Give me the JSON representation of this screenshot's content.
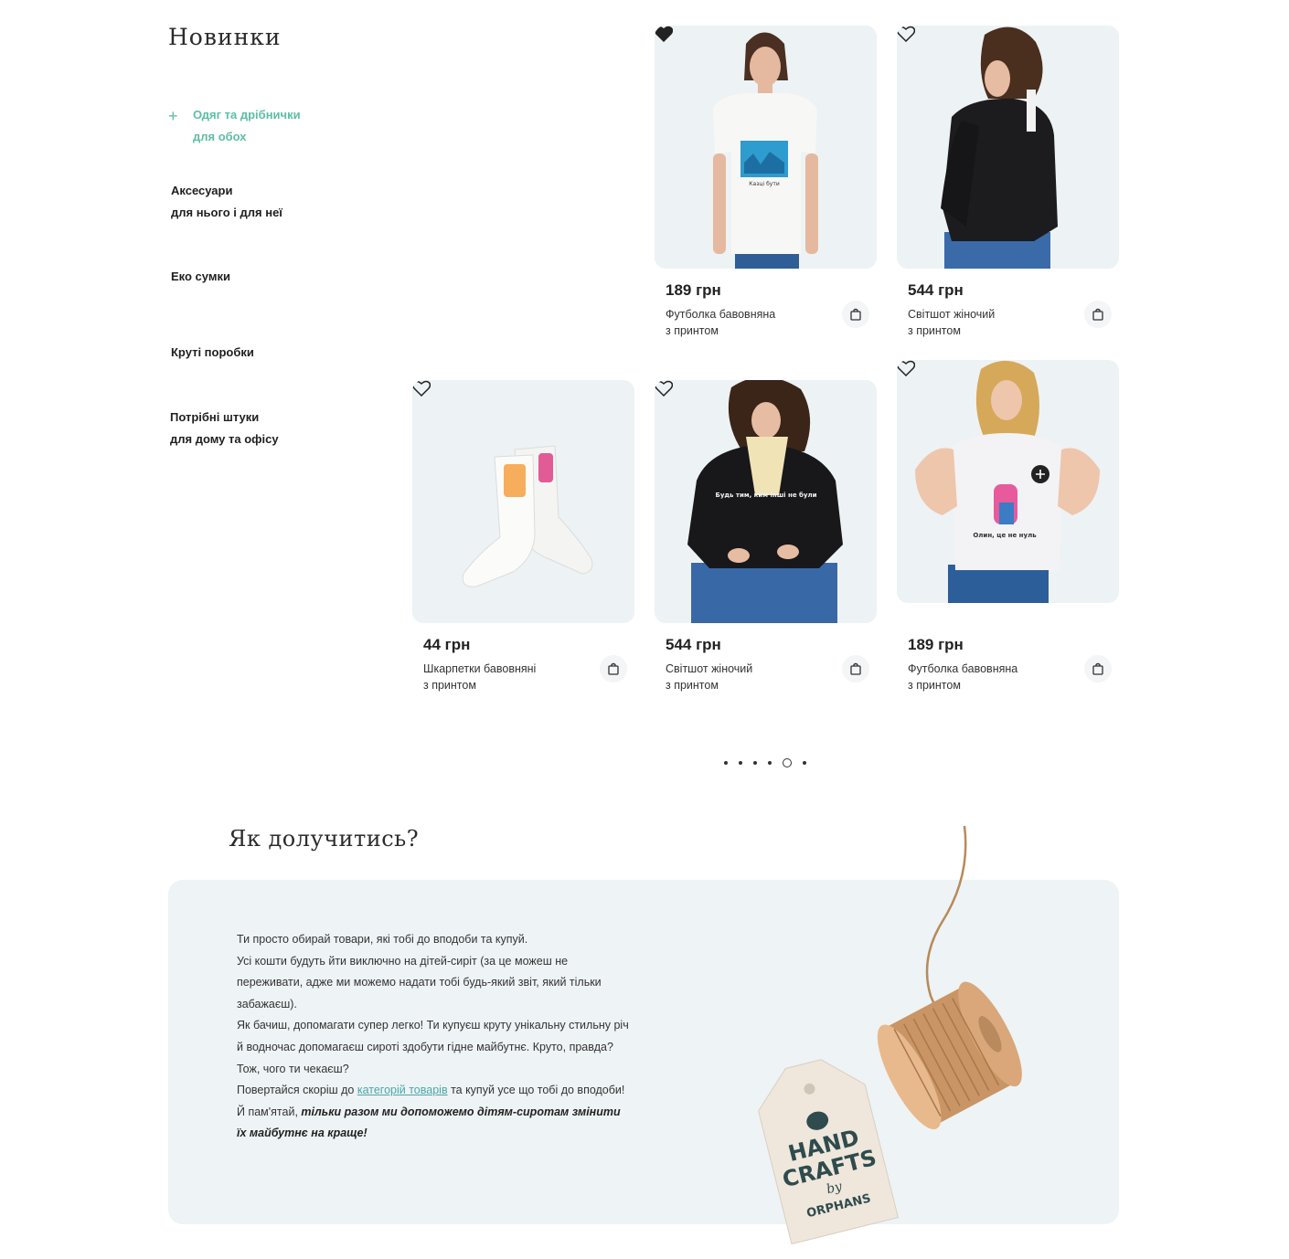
{
  "sections": {
    "new_title": "Новинки",
    "join_title": "Як долучитись?"
  },
  "categories": [
    {
      "line1": "Одяг та дрібнички",
      "line2": "для обох",
      "active": true
    },
    {
      "line1": "Аксесуари",
      "line2": "для нього і для неї",
      "active": false
    },
    {
      "line1": "Еко сумки",
      "line2": "",
      "active": false
    },
    {
      "line1": "Круті поробки",
      "line2": "",
      "active": false
    },
    {
      "line1": "Потрібні штуки",
      "line2": "для дому та офісу",
      "active": false
    }
  ],
  "products": [
    {
      "price": "189 грн",
      "name_line1": "Футболка бавовняна",
      "name_line2": "з принтом",
      "favorite": true,
      "image": "woman-white-tshirt"
    },
    {
      "price": "544 грн",
      "name_line1": "Світшот жіночий",
      "name_line2": "з принтом",
      "favorite": false,
      "image": "woman-black-sweatshirt-back"
    },
    {
      "price": "44 грн",
      "name_line1": "Шкарпетки бавовняні",
      "name_line2": "з принтом",
      "favorite": false,
      "image": "white-socks"
    },
    {
      "price": "544 грн",
      "name_line1": "Світшот жіночий",
      "name_line2": "з принтом",
      "favorite": false,
      "image": "woman-black-sweatshirt-front"
    },
    {
      "price": "189 грн",
      "name_line1": "Футболка бавовняна",
      "name_line2": "з принтом",
      "favorite": false,
      "image": "woman-white-tshirt-smiling"
    }
  ],
  "print_labels": {
    "tshirt1": "Казці бути",
    "sweatshirt": "Будь тим, ким інші не були",
    "tshirt2": "Олин, це не нуль"
  },
  "pagination": {
    "count": 6,
    "active_index": 4
  },
  "join_text": {
    "p1": "Ти просто обирай товари, які тобі до вподоби та купуй.",
    "p2": "Усі кошти будуть йти виключно на дітей-сиріт (за це можеш не переживати, адже ми можемо надати тобі будь-який звіт, який тільки забажаєш).",
    "p3": "Як бачиш, допомагати супер легко! Ти купуєш круту унікальну стильну річ й водночас допомагаєш сироті здобути гідне майбутнє. Круто, правда?",
    "p4": "Тож, чого ти чекаєш?",
    "p5_before": "Повертайся скоріш до ",
    "p5_link": "категорій товарів",
    "p5_after": " та купуй усе що тобі до вподоби!",
    "p6_before": "Й пам'ятай, ",
    "p6_bold": "тільки разом ми допоможемо дітям-сиротам змінити їх майбутнє на краще!"
  },
  "tag_logo": {
    "line1": "HAND",
    "line2": "CRAFTS",
    "line3": "by",
    "line4": "ORPHANS"
  },
  "colors": {
    "accent": "#5cbfa3",
    "card_bg": "#edf2f4",
    "panel_bg": "#eef3f5",
    "link": "#4aa8a8"
  }
}
